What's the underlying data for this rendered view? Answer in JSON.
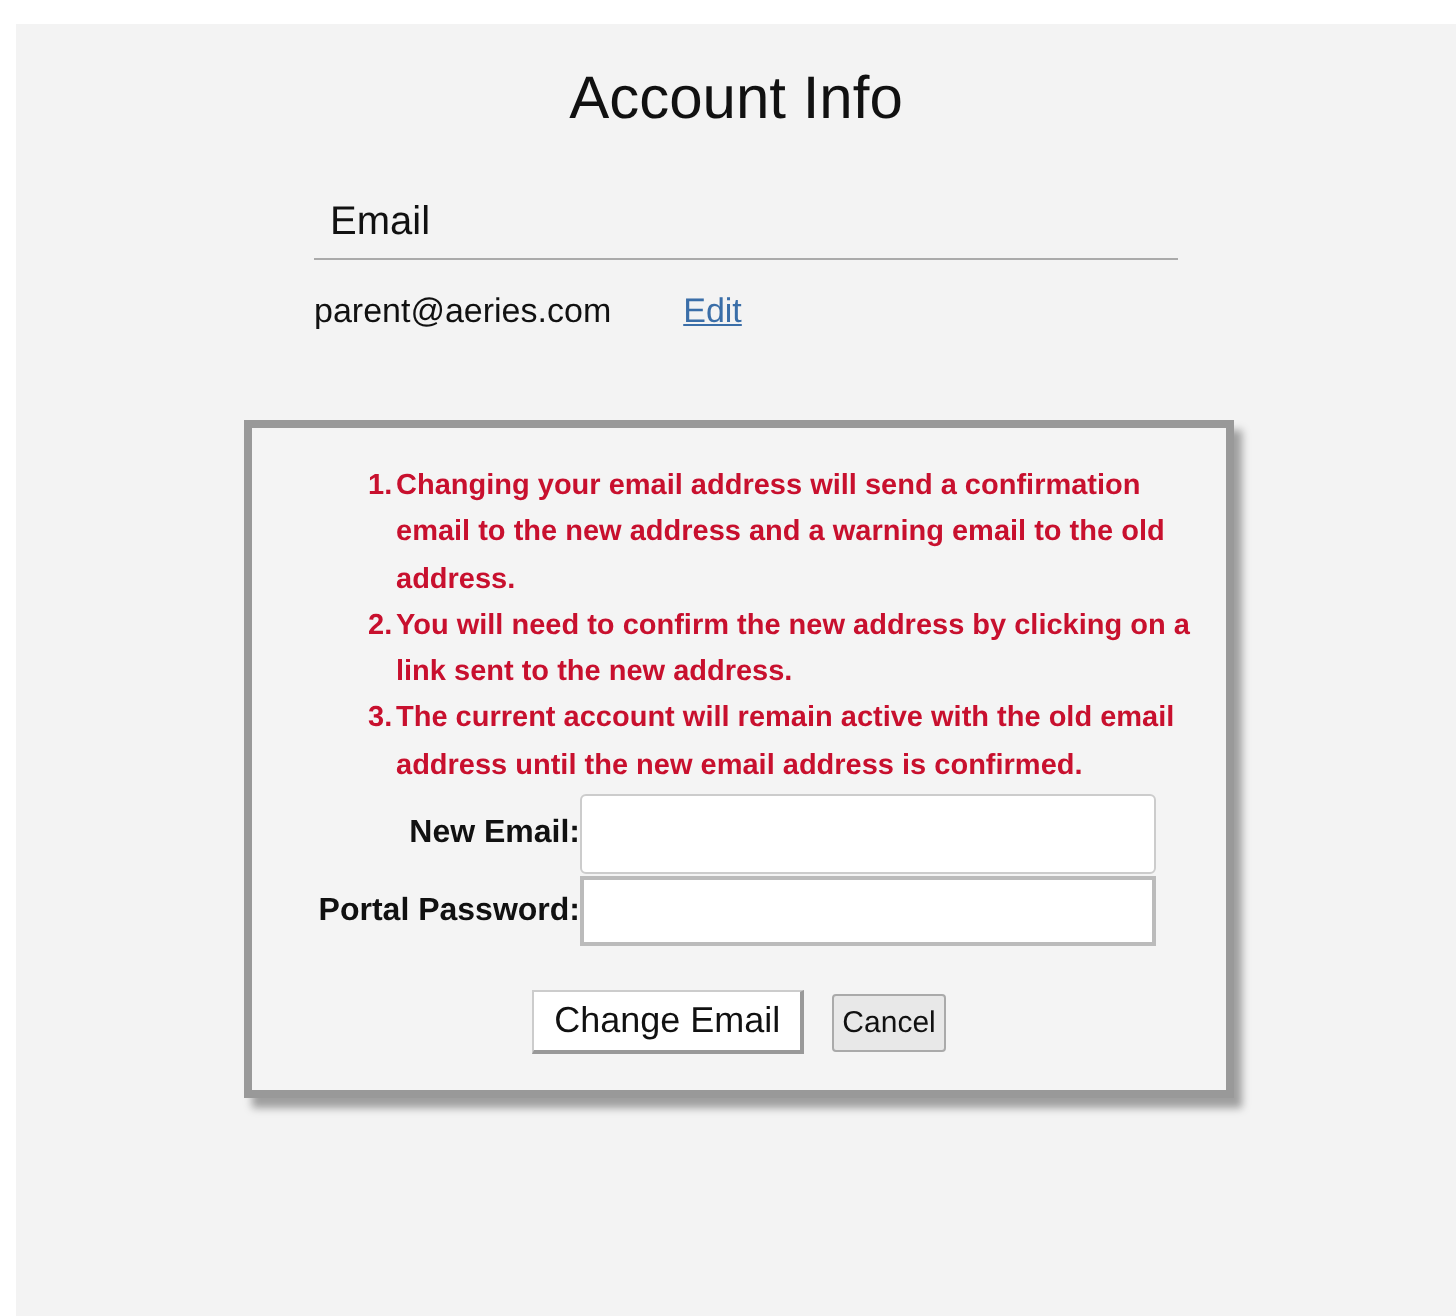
{
  "page": {
    "title": "Account Info"
  },
  "email_section": {
    "heading": "Email",
    "value": "parent@aeries.com",
    "edit_link": "Edit"
  },
  "dialog": {
    "notes": [
      {
        "number": "1.",
        "text": "Changing your email address will send a confirmation email to the new address and a warning email to the old address."
      },
      {
        "number": "2.",
        "text": "You will need to confirm the new address by clicking on a link sent to the new address."
      },
      {
        "number": "3.",
        "text": "The current account will remain active with the old email address until the new email address is confirmed."
      }
    ],
    "fields": [
      {
        "label": "New Email:",
        "kind": "text"
      },
      {
        "label": "Portal Password:",
        "kind": "password"
      }
    ],
    "buttons": [
      {
        "label": "Change Email",
        "kind": "primary"
      },
      {
        "label": "Cancel",
        "kind": "secondary"
      }
    ]
  }
}
